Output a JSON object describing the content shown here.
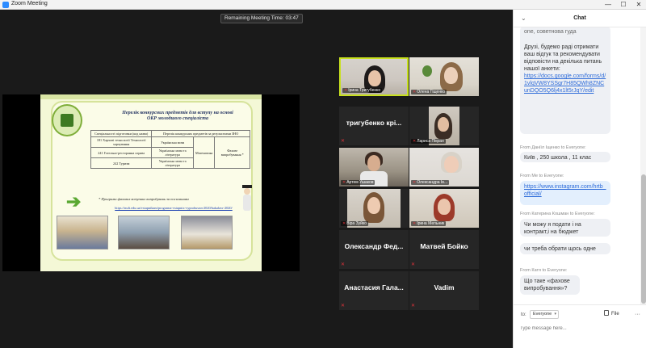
{
  "window": {
    "title": "Zoom Meeting",
    "minimize": "—",
    "maximize": "☐",
    "close": "✕"
  },
  "meeting": {
    "timer": "Remaining Meeting Time: 03:47"
  },
  "slide": {
    "title": "Перелік конкурсних предметів для вступу на основі ОКР молодшого спеціаліста",
    "table_header": [
      "Спеціальності підготовки (код назва)",
      "Перелік конкурсних предметів за результатами ЗНО",
      "",
      ""
    ],
    "table_rows": [
      [
        "181 Харчові технології Технології харчування",
        "Українська мова",
        "",
        ""
      ],
      [
        "241 Готельно-ресторанна справа",
        "Українська мова та література",
        "Математика",
        "Фахове випробування *"
      ],
      [
        "242 Туризм",
        "Українська мова та література",
        "",
        ""
      ]
    ],
    "note": "* Програми фахових вступних випробувань за посиланням",
    "link": "https://nuft.edu.ua/vstupnikam/programa-vstupnix-vyprobuvan-2020/bakalavr-2020/"
  },
  "participants": [
    {
      "name": "Ірина Тригубенко",
      "muted": true,
      "active": true
    },
    {
      "name": "Олена Гіщенко",
      "muted": true,
      "active": false
    },
    {
      "name": "тригубенко крі...",
      "muted": true,
      "active": false
    },
    {
      "name": "Лариса Пікран",
      "muted": true,
      "active": false
    },
    {
      "name": "Артем Ушаков",
      "muted": true,
      "active": false
    },
    {
      "name": "Олександра Ів...",
      "muted": true,
      "active": false
    },
    {
      "name": "Віра Зуйко",
      "muted": true,
      "active": false
    },
    {
      "name": "Ірина Мельник",
      "muted": true,
      "active": false
    },
    {
      "name": "Олександр Фед...",
      "muted": true,
      "active": false
    },
    {
      "name": "Матвей Бойко",
      "muted": true,
      "active": false
    },
    {
      "name": "Анастасия Гала...",
      "muted": true,
      "active": false
    },
    {
      "name": "Vadim",
      "muted": true,
      "active": false
    }
  ],
  "chat": {
    "title": "Chat",
    "msg1_top": "one, советнова гуда",
    "msg1": "Друзі, будемо раді отримати ваш відгук та рекомендувати відповісти на декілька питань нашої анкети:",
    "msg1_link": "https://docs.google.com/forms/d/1vlqVW8YSSgr7H85QWh8ZNCunDQO5Q6lj4x1lt5rJqY/edit",
    "s2_from": "From Даніїл Іщенко to Everyone:",
    "msg2": "Київ , 250 школа , 11 клас",
    "s3_from": "From Me to Everyone:",
    "msg3_link": "https://www.instagram.com/hrtb_official/",
    "s4_from": "From Катерина Кошман to Everyone:",
    "msg4a": "Чи можу я подати і на контракт,і на бюджет",
    "msg4b": "чи треба обрати щось одне",
    "s5_from": "From Катя to Everyone:",
    "msg5": "Що таке «фахове випробування»?",
    "to_label": "to:",
    "to_value": "Everyone",
    "file_label": "File",
    "more": "···",
    "input_placeholder": "Type message here..."
  }
}
